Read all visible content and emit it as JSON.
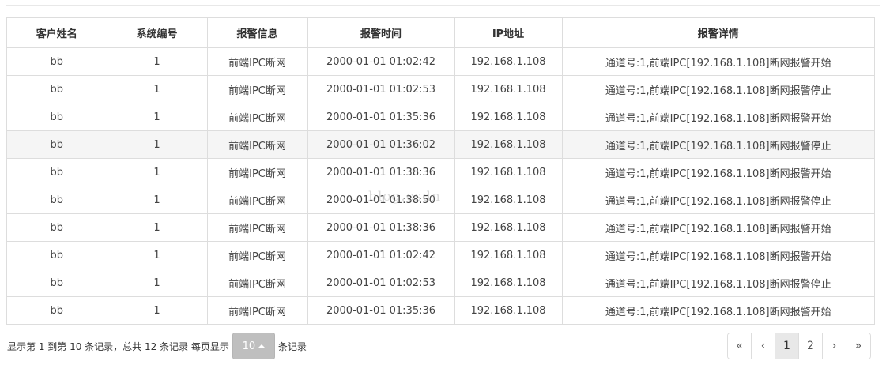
{
  "table": {
    "columns": [
      "客户姓名",
      "系统编号",
      "报警信息",
      "报警时间",
      "IP地址",
      "报警详情"
    ],
    "rows": [
      [
        "bb",
        "1",
        "前端IPC断网",
        "2000-01-01 01:02:42",
        "192.168.1.108",
        "通道号:1,前端IPC[192.168.1.108]断网报警开始"
      ],
      [
        "bb",
        "1",
        "前端IPC断网",
        "2000-01-01 01:02:53",
        "192.168.1.108",
        "通道号:1,前端IPC[192.168.1.108]断网报警停止"
      ],
      [
        "bb",
        "1",
        "前端IPC断网",
        "2000-01-01 01:35:36",
        "192.168.1.108",
        "通道号:1,前端IPC[192.168.1.108]断网报警开始"
      ],
      [
        "bb",
        "1",
        "前端IPC断网",
        "2000-01-01 01:36:02",
        "192.168.1.108",
        "通道号:1,前端IPC[192.168.1.108]断网报警停止"
      ],
      [
        "bb",
        "1",
        "前端IPC断网",
        "2000-01-01 01:38:36",
        "192.168.1.108",
        "通道号:1,前端IPC[192.168.1.108]断网报警开始"
      ],
      [
        "bb",
        "1",
        "前端IPC断网",
        "2000-01-01 01:38:50",
        "192.168.1.108",
        "通道号:1,前端IPC[192.168.1.108]断网报警停止"
      ],
      [
        "bb",
        "1",
        "前端IPC断网",
        "2000-01-01 01:38:36",
        "192.168.1.108",
        "通道号:1,前端IPC[192.168.1.108]断网报警开始"
      ],
      [
        "bb",
        "1",
        "前端IPC断网",
        "2000-01-01 01:02:42",
        "192.168.1.108",
        "通道号:1,前端IPC[192.168.1.108]断网报警开始"
      ],
      [
        "bb",
        "1",
        "前端IPC断网",
        "2000-01-01 01:02:53",
        "192.168.1.108",
        "通道号:1,前端IPC[192.168.1.108]断网报警停止"
      ],
      [
        "bb",
        "1",
        "前端IPC断网",
        "2000-01-01 01:35:36",
        "192.168.1.108",
        "通道号:1,前端IPC[192.168.1.108]断网报警开始"
      ]
    ],
    "hovered_row": 3
  },
  "watermark": "blog.csdn",
  "pager": {
    "summary_prefix": "显示第 1 到第 10 条记录，总共 12 条记录 每页显示",
    "page_size": "10",
    "summary_suffix": "条记录",
    "first": "«",
    "prev": "‹",
    "pages": [
      "1",
      "2"
    ],
    "active_page": "1",
    "next": "›",
    "last": "»"
  },
  "colors": {
    "border": "#dddddd",
    "hover_row": "#f5f5f5",
    "page_size_button": "#bfbfbf",
    "active_page": "#e8e8e8"
  }
}
